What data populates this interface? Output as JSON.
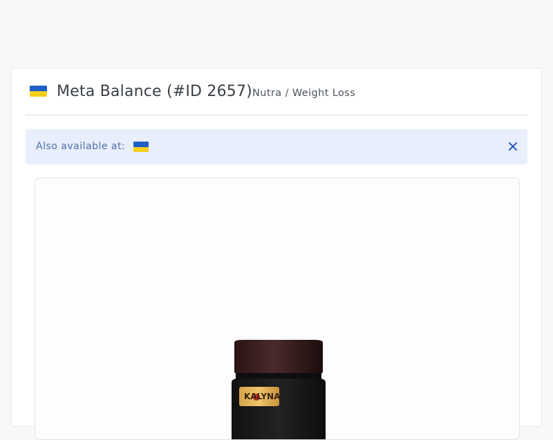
{
  "offer": {
    "title": "Meta Balance (#ID 2657)",
    "category": "Nutra / Weight Loss",
    "country_flag": "ukraine-flag-icon"
  },
  "alert": {
    "label": "Also available at:",
    "flags": [
      "ukraine-flag-icon"
    ],
    "close_icon": "close-icon"
  },
  "product": {
    "label": "KALYNA"
  },
  "colors": {
    "flag_blue": "#1f5fc6",
    "flag_yellow": "#f7cf1a",
    "alert_bg": "#e8eefb",
    "alert_text": "#4d6fa6",
    "close_icon": "#2b5fb8"
  }
}
